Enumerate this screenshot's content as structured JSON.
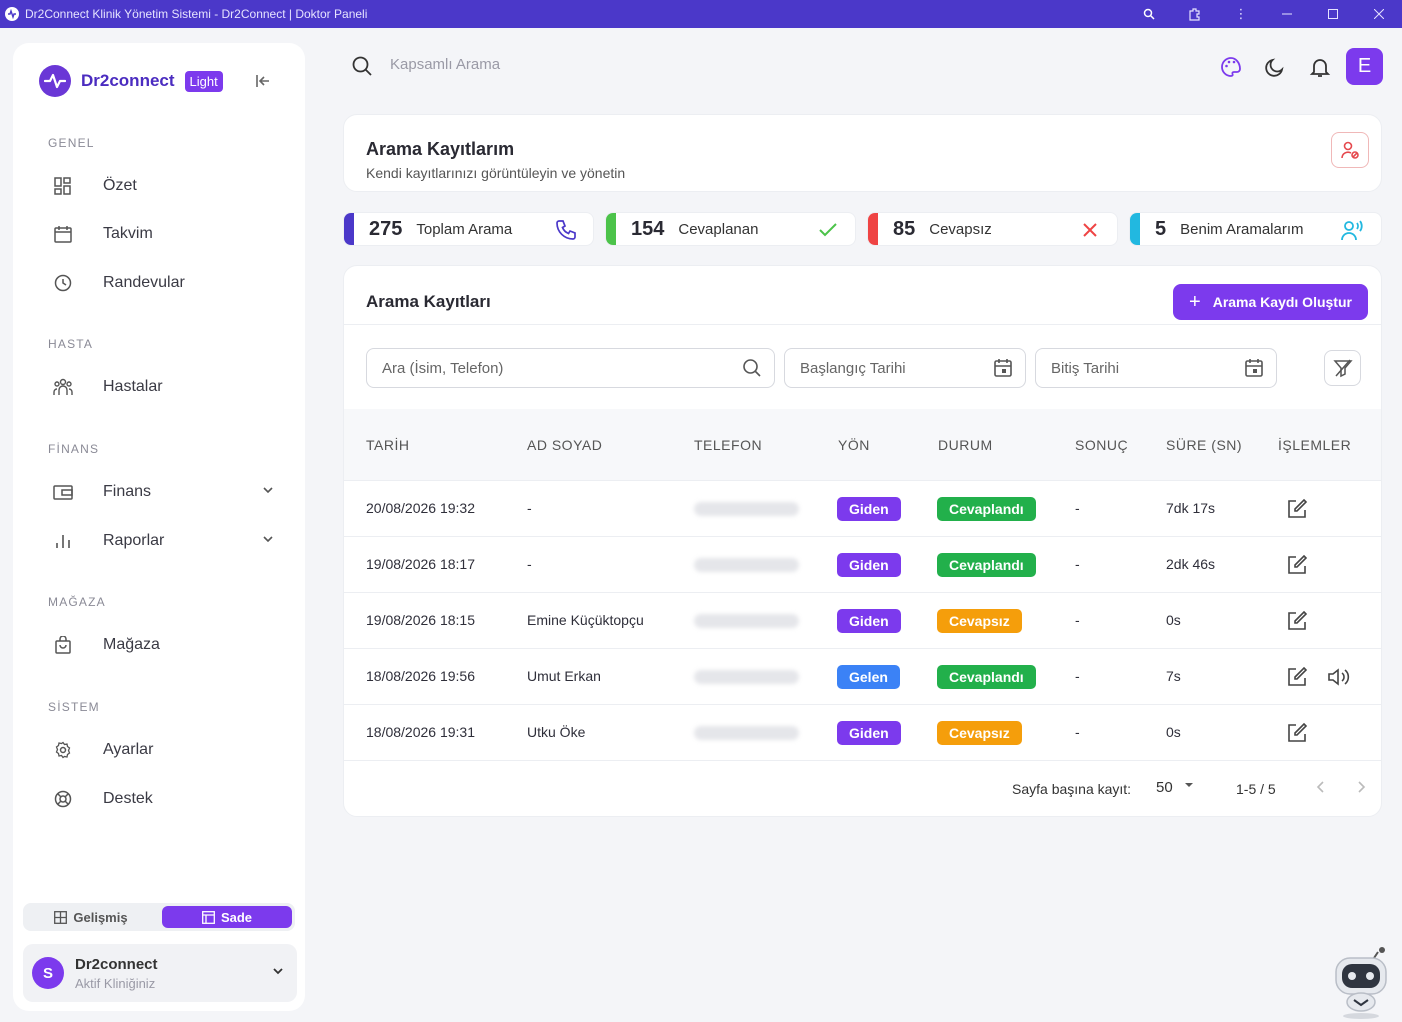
{
  "window": {
    "title": "Dr2Connect Klinik Yönetim Sistemi - Dr2Connect | Doktor Paneli"
  },
  "sidebar": {
    "brand": "Dr2connect",
    "theme_badge": "Light",
    "sections": {
      "general": "GENEL",
      "patient": "HASTA",
      "finance": "FİNANS",
      "store": "MAĞAZA",
      "system": "SİSTEM"
    },
    "items": [
      {
        "label": "Özet",
        "icon": "dashboard-icon"
      },
      {
        "label": "Takvim",
        "icon": "calendar-icon"
      },
      {
        "label": "Randevular",
        "icon": "clock-icon"
      },
      {
        "label": "Hastalar",
        "icon": "users-icon"
      },
      {
        "label": "Finans",
        "icon": "wallet-icon"
      },
      {
        "label": "Raporlar",
        "icon": "bar-chart-icon"
      },
      {
        "label": "Mağaza",
        "icon": "shopping-bag-icon"
      },
      {
        "label": "Ayarlar",
        "icon": "gear-icon"
      },
      {
        "label": "Destek",
        "icon": "lifebuoy-icon"
      }
    ],
    "mode_advanced": "Gelişmiş",
    "mode_simple": "Sade",
    "clinic_name": "Dr2connect",
    "clinic_sub": "Aktif Kliniğiniz",
    "clinic_initial": "S"
  },
  "topbar": {
    "search_placeholder": "Kapsamlı Arama",
    "user_initial": "E"
  },
  "header": {
    "title": "Arama Kayıtlarım",
    "subtitle": "Kendi kayıtlarınızı görüntüleyin ve yönetin"
  },
  "stats": [
    {
      "value": "275",
      "label": "Toplam Arama",
      "color": "#4b38c9"
    },
    {
      "value": "154",
      "label": "Cevaplanan",
      "color": "#4cc34a"
    },
    {
      "value": "85",
      "label": "Cevapsız",
      "color": "#ef4444"
    },
    {
      "value": "5",
      "label": "Benim Aramalarım",
      "color": "#22b8e0"
    }
  ],
  "table": {
    "title": "Arama Kayıtları",
    "create_label": "Arama Kaydı Oluştur",
    "search_placeholder": "Ara (İsim, Telefon)",
    "start_date_placeholder": "Başlangıç Tarihi",
    "end_date_placeholder": "Bitiş Tarihi",
    "columns": [
      "TARİH",
      "AD SOYAD",
      "TELEFON",
      "YÖN",
      "DURUM",
      "SONUÇ",
      "SÜRE (SN)",
      "İŞLEMLER"
    ],
    "rows": [
      {
        "date": "20/08/2026 19:32",
        "name": "-",
        "direction": "Giden",
        "status": "Cevaplandı",
        "result": "-",
        "duration": "7dk 17s",
        "has_audio": false
      },
      {
        "date": "19/08/2026 18:17",
        "name": "-",
        "direction": "Giden",
        "status": "Cevaplandı",
        "result": "-",
        "duration": "2dk 46s",
        "has_audio": false
      },
      {
        "date": "19/08/2026 18:15",
        "name": "Emine Küçüktopçu",
        "direction": "Giden",
        "status": "Cevapsız",
        "result": "-",
        "duration": "0s",
        "has_audio": false
      },
      {
        "date": "18/08/2026 19:56",
        "name": "Umut Erkan",
        "direction": "Gelen",
        "status": "Cevaplandı",
        "result": "-",
        "duration": "7s",
        "has_audio": true
      },
      {
        "date": "18/08/2026 19:31",
        "name": "Utku Öke",
        "direction": "Giden",
        "status": "Cevapsız",
        "result": "-",
        "duration": "0s",
        "has_audio": false
      }
    ],
    "per_page_label": "Sayfa başına kayıt:",
    "per_page_value": "50",
    "range": "1-5 / 5"
  },
  "colors": {
    "accent": "#7c3aed",
    "outgoing": "#7c3aed",
    "incoming": "#3b82f6",
    "answered": "#22b04b",
    "missed": "#f59e0b"
  }
}
